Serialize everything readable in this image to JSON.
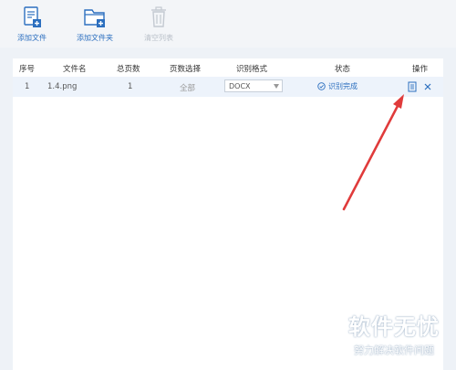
{
  "toolbar": {
    "add_file": "添加文件",
    "add_folder": "添加文件夹",
    "clear_list": "清空列表"
  },
  "table": {
    "headers": [
      "序号",
      "文件名",
      "总页数",
      "页数选择",
      "识别格式",
      "状态",
      "操作"
    ],
    "rows": [
      {
        "index": "1",
        "filename": "1.4.png",
        "pages": "1",
        "page_select": "全部",
        "format": "DOCX",
        "status": "识别完成"
      }
    ]
  },
  "watermark": {
    "title": "软件无忧",
    "subtitle": "努力解决软件问题"
  },
  "colors": {
    "accent": "#2c6fbf",
    "arrow": "#e03b3b",
    "row_bg": "#edf3fb"
  }
}
